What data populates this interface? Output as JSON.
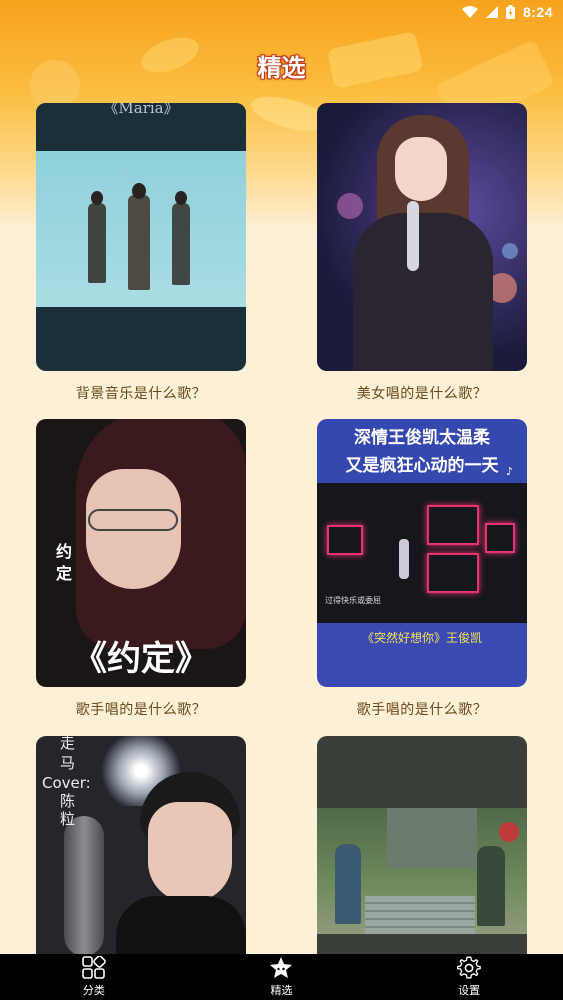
{
  "status_bar": {
    "time": "8:24",
    "icons": [
      "wifi-icon",
      "signal-icon",
      "battery-icon"
    ]
  },
  "header": {
    "title": "精选"
  },
  "cards": [
    {
      "caption": "背景音乐是什么歌？",
      "overlay_text": "《Maria》"
    },
    {
      "caption": "美女唱的是什么歌？"
    },
    {
      "caption": "歌手唱的是什么歌？",
      "overlay_side_text": "约定",
      "overlay_big_text": "《约定》"
    },
    {
      "caption": "歌手唱的是什么歌？",
      "overlay_line1": "深情王俊凯太温柔",
      "overlay_line2": "又是疯狂心动的一天",
      "overlay_sub": "过得快乐或委屈",
      "overlay_bottom": "《突然好想你》王俊凯"
    },
    {
      "caption": "",
      "overlay_lines": [
        "走",
        "马",
        "Cover:",
        "陈",
        "粒"
      ]
    },
    {
      "caption": ""
    }
  ],
  "bottom_nav": {
    "items": [
      {
        "label": "分类",
        "icon": "grid-icon"
      },
      {
        "label": "精选",
        "icon": "star-icon"
      },
      {
        "label": "设置",
        "icon": "gear-icon"
      }
    ]
  },
  "colors": {
    "header_gradient_top": "#f7a21e",
    "background": "#fdf0d6",
    "caption_text": "#6a4b1f",
    "title_outline": "#c0391b",
    "nav_background": "#000000"
  }
}
